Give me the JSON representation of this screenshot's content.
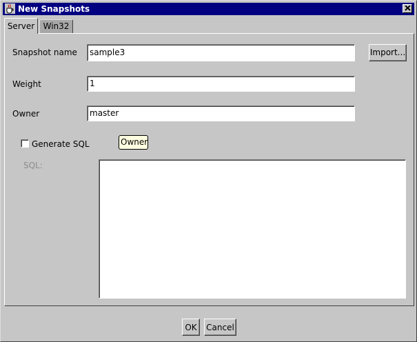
{
  "window": {
    "title": "New Snapshots",
    "title_icon": "java-cup-icon",
    "close_icon": "close-icon"
  },
  "tabs": [
    {
      "label": "Server",
      "selected": true
    },
    {
      "label": "Win32",
      "selected": false
    }
  ],
  "form": {
    "snapshot_name": {
      "label": "Snapshot name",
      "value": "sample3"
    },
    "import_label": "Import...",
    "weight": {
      "label": "Weight",
      "value": "1"
    },
    "owner": {
      "label": "Owner",
      "value": "master"
    },
    "generate_sql": {
      "label": "Generate SQL",
      "checked": false
    },
    "tooltip": "Owner",
    "sql": {
      "label": "SQL:",
      "value": "",
      "enabled": false
    }
  },
  "footer": {
    "ok_label": "OK",
    "cancel_label": "Cancel"
  },
  "colors": {
    "titlebar": "#000080",
    "face": "#c6c6c6",
    "tooltip_bg": "#ffffe1",
    "disabled_text": "#8c8c8c"
  }
}
